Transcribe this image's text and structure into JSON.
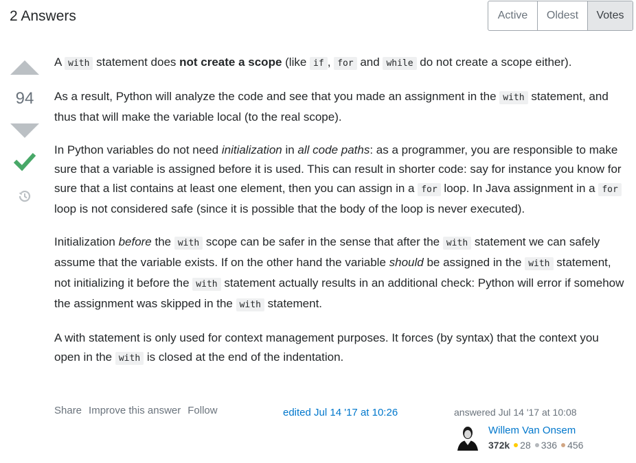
{
  "header": {
    "title": "2 Answers",
    "sort_tabs": [
      {
        "label": "Active"
      },
      {
        "label": "Oldest"
      },
      {
        "label": "Votes",
        "selected": true
      }
    ]
  },
  "vote": {
    "count": "94",
    "accepted": true
  },
  "answer": {
    "p1": {
      "t1": "A ",
      "c1": "with",
      "t2": " statement does ",
      "b1": "not create a scope",
      "t3": " (like ",
      "c2": "if",
      "t4": ", ",
      "c3": "for",
      "t5": " and ",
      "c4": "while",
      "t6": " do not create a scope either)."
    },
    "p2": {
      "t1": "As a result, Python will analyze the code and see that you made an assignment in the ",
      "c1": "with",
      "t2": " statement, and thus that will make the variable local (to the real scope)."
    },
    "p3": {
      "t1": "In Python variables do not need ",
      "i1": "initialization",
      "t2": " in ",
      "i2": "all code paths",
      "t3": ": as a programmer, you are responsible to make sure that a variable is assigned before it is used. This can result in shorter code: say for instance you know for sure that a list contains at least one element, then you can assign in a ",
      "c1": "for",
      "t4": " loop. In Java assignment in a ",
      "c2": "for",
      "t5": " loop is not considered safe (since it is possible that the body of the loop is never executed)."
    },
    "p4": {
      "t1": "Initialization ",
      "i1": "before",
      "t2": " the ",
      "c1": "with",
      "t3": " scope can be safer in the sense that after the ",
      "c2": "with",
      "t4": " statement we can safely assume that the variable exists. If on the other hand the variable ",
      "i2": "should",
      "t5": " be assigned in the ",
      "c3": "with",
      "t6": " statement, not initializing it before the ",
      "c4": "with",
      "t7": " statement actually results in an additional check: Python will error if somehow the assignment was skipped in the ",
      "c5": "with",
      "t8": " statement."
    },
    "p5": {
      "t1": "A with statement is only used for context management purposes. It forces (by syntax) that the context you open in the ",
      "c1": "with",
      "t2": " is closed at the end of the indentation."
    }
  },
  "post_menu": {
    "share": "Share",
    "improve": "Improve this answer",
    "follow": "Follow"
  },
  "edited": "edited Jul 14 '17 at 10:26",
  "user": {
    "answered": "answered Jul 14 '17 at 10:08",
    "name": "Willem Van Onsem",
    "reputation": "372k",
    "gold": "28",
    "silver": "336",
    "bronze": "456"
  },
  "colors": {
    "accent": "#0077cc",
    "accepted": "#48a868",
    "vote_arrow": "#bbc0c4"
  }
}
